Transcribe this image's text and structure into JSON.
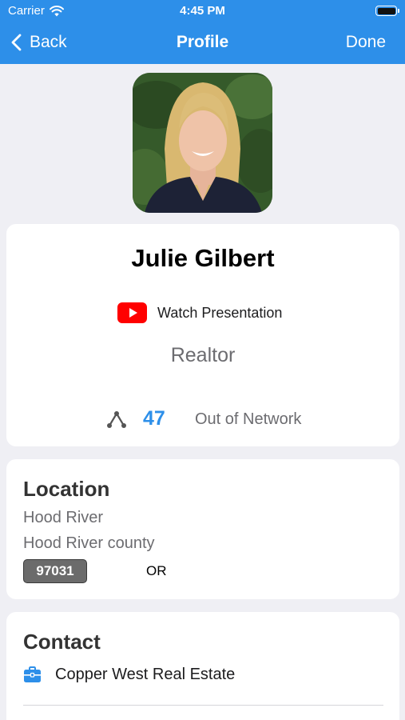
{
  "status_bar": {
    "carrier": "Carrier",
    "time": "4:45 PM"
  },
  "nav": {
    "back_label": "Back",
    "title": "Profile",
    "done_label": "Done"
  },
  "profile": {
    "name": "Julie Gilbert",
    "presentation_label": "Watch Presentation",
    "role": "Realtor",
    "network_count": "47",
    "network_status": "Out of Network"
  },
  "location": {
    "title": "Location",
    "city": "Hood River",
    "county": "Hood River county",
    "zip": "97031",
    "state": "OR"
  },
  "contact": {
    "title": "Contact",
    "company": "Copper West Real Estate"
  },
  "colors": {
    "accent": "#2d8fe9",
    "background": "#efeff4",
    "youtube": "#ff0000"
  },
  "icons": [
    "wifi-icon",
    "battery-icon",
    "back-chevron-icon",
    "youtube-icon",
    "network-icon",
    "briefcase-icon"
  ]
}
